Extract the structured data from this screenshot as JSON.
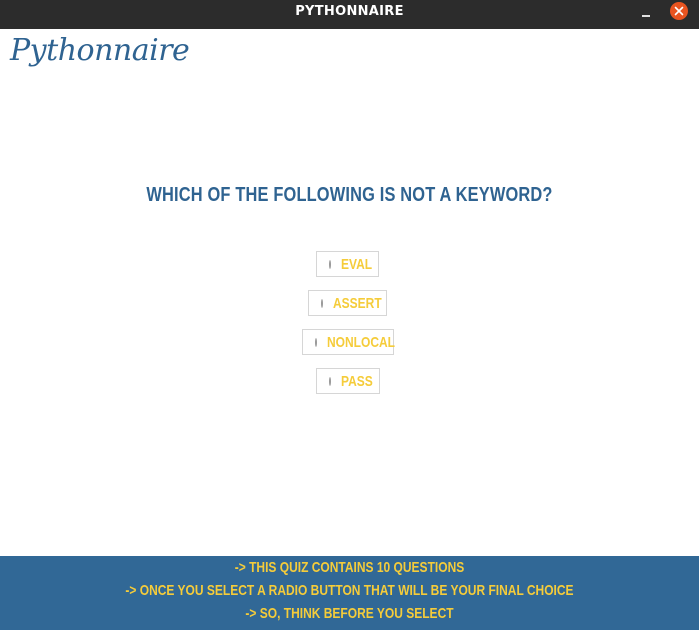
{
  "window": {
    "title": "PYTHONNAIRE"
  },
  "logo": {
    "text": "Pythonnaire"
  },
  "question": {
    "text": "WHICH OF THE FOLLOWING IS NOT A KEYWORD?"
  },
  "options": [
    {
      "label": "EVAL",
      "selected": false
    },
    {
      "label": "ASSERT",
      "selected": false
    },
    {
      "label": "NONLOCAL",
      "selected": false
    },
    {
      "label": "PASS",
      "selected": false
    }
  ],
  "footer": {
    "lines": [
      "-> THIS QUIZ CONTAINS 10 QUESTIONS",
      "-> ONCE YOU SELECT A RADIO BUTTON THAT WILL BE YOUR FINAL CHOICE",
      "-> SO, THINK BEFORE YOU SELECT"
    ]
  },
  "colors": {
    "titlebar": "#2c2c2c",
    "primary_blue": "#2f6391",
    "footer_blue": "#316896",
    "accent_yellow": "#f5cc3a",
    "close_button": "#e95420"
  },
  "icons": {
    "minimize": "minimize-icon",
    "close": "close-icon",
    "radio": "radio-unchecked-icon"
  }
}
